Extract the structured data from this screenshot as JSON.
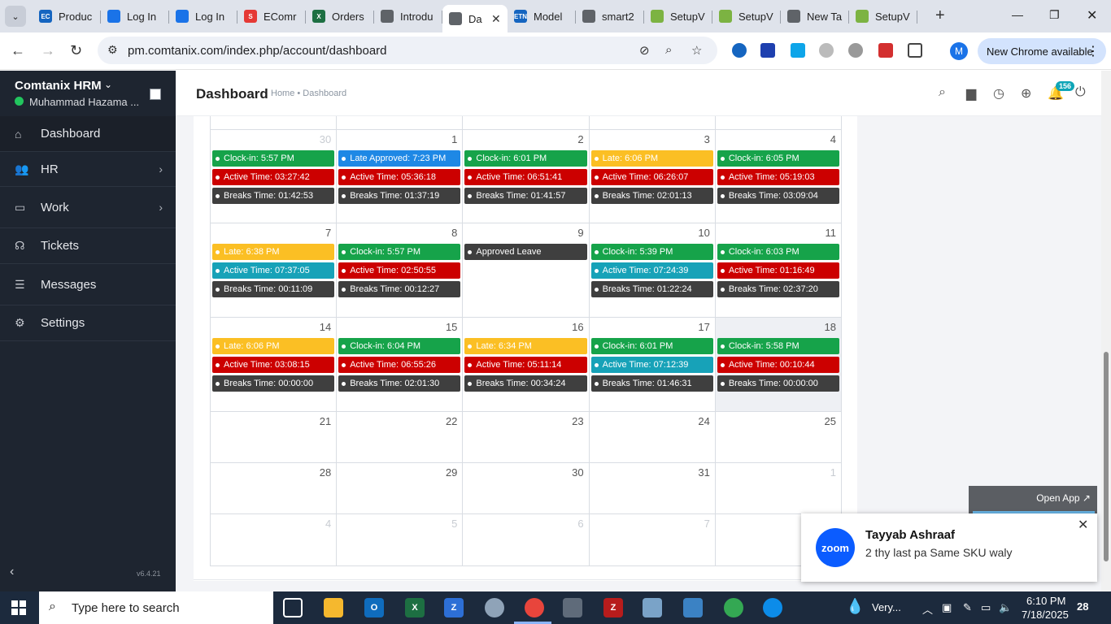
{
  "browser": {
    "tabs": [
      {
        "title": "Produc",
        "fav_text": "EC",
        "fav_color": "#1565c0",
        "active": false
      },
      {
        "title": "Log In",
        "fav_text": "",
        "fav_color": "#1a73e8",
        "active": false
      },
      {
        "title": "Log In",
        "fav_text": "",
        "fav_color": "#1a73e8",
        "active": false
      },
      {
        "title": "EComr",
        "fav_text": "S",
        "fav_color": "#e53935",
        "active": false
      },
      {
        "title": "Orders",
        "fav_text": "X",
        "fav_color": "#1d6f42",
        "active": false
      },
      {
        "title": "Introdu",
        "fav_text": "",
        "fav_color": "#5f6368",
        "active": false
      },
      {
        "title": "Da",
        "fav_text": "",
        "fav_color": "#5f6368",
        "active": true
      },
      {
        "title": "Model",
        "fav_text": "ETN",
        "fav_color": "#1565c0",
        "active": false
      },
      {
        "title": "smart2",
        "fav_text": "",
        "fav_color": "#5f6368",
        "active": false
      },
      {
        "title": "SetupV",
        "fav_text": "",
        "fav_color": "#7cb342",
        "active": false
      },
      {
        "title": "SetupV",
        "fav_text": "",
        "fav_color": "#7cb342",
        "active": false
      },
      {
        "title": "New Ta",
        "fav_text": "",
        "fav_color": "#5f6368",
        "active": false
      },
      {
        "title": "SetupV",
        "fav_text": "",
        "fav_color": "#7cb342",
        "active": false
      }
    ],
    "url": "pm.comtanix.com/index.php/account/dashboard",
    "profile_initial": "M",
    "update_label": "New Chrome available"
  },
  "sidebar": {
    "brand": "Comtanix HRM",
    "user": "Muhammad Hazama ...",
    "items": [
      {
        "label": "Dashboard",
        "icon": "home-icon",
        "glyph": "⌂",
        "chevron": false,
        "active": true
      },
      {
        "label": "HR",
        "icon": "users-icon",
        "glyph": "👥",
        "chevron": true,
        "active": false
      },
      {
        "label": "Work",
        "icon": "briefcase-icon",
        "glyph": "▭",
        "chevron": true,
        "active": false
      },
      {
        "label": "Tickets",
        "icon": "headset-icon",
        "glyph": "☊",
        "chevron": false,
        "active": false
      },
      {
        "label": "Messages",
        "icon": "messages-icon",
        "glyph": "☰",
        "chevron": false,
        "active": false
      },
      {
        "label": "Settings",
        "icon": "gear-icon",
        "glyph": "⚙",
        "chevron": false,
        "active": false
      }
    ],
    "version": "v6.4.21"
  },
  "header": {
    "title": "Dashboard",
    "breadcrumb": "Home • Dashboard",
    "notification_count": "156"
  },
  "calendar": {
    "weeks": [
      {
        "height": 115,
        "days": [
          {
            "num": "30",
            "other": true,
            "events": [
              {
                "text": "Clock-in: 5:57 PM",
                "color": "green"
              },
              {
                "text": "Active Time: 03:27:42",
                "color": "red"
              },
              {
                "text": "Breaks Time: 01:42:53",
                "color": "dark"
              }
            ]
          },
          {
            "num": "1",
            "other": false,
            "events": [
              {
                "text": "Late Approved: 7:23 PM",
                "color": "blue"
              },
              {
                "text": "Active Time: 05:36:18",
                "color": "red"
              },
              {
                "text": "Breaks Time: 01:37:19",
                "color": "dark"
              }
            ]
          },
          {
            "num": "2",
            "other": false,
            "events": [
              {
                "text": "Clock-in: 6:01 PM",
                "color": "green"
              },
              {
                "text": "Active Time: 06:51:41",
                "color": "red"
              },
              {
                "text": "Breaks Time: 01:41:57",
                "color": "dark"
              }
            ]
          },
          {
            "num": "3",
            "other": false,
            "events": [
              {
                "text": "Late: 6:06 PM",
                "color": "yellow"
              },
              {
                "text": "Active Time: 06:26:07",
                "color": "red"
              },
              {
                "text": "Breaks Time: 02:01:13",
                "color": "dark"
              }
            ]
          },
          {
            "num": "4",
            "other": false,
            "events": [
              {
                "text": "Clock-in: 6:05 PM",
                "color": "green"
              },
              {
                "text": "Active Time: 05:19:03",
                "color": "red"
              },
              {
                "text": "Breaks Time: 03:09:04",
                "color": "dark"
              }
            ]
          }
        ]
      },
      {
        "height": 116,
        "days": [
          {
            "num": "7",
            "other": false,
            "events": [
              {
                "text": "Late: 6:38 PM",
                "color": "yellow"
              },
              {
                "text": "Active Time: 07:37:05",
                "color": "teal"
              },
              {
                "text": "Breaks Time: 00:11:09",
                "color": "dark"
              }
            ]
          },
          {
            "num": "8",
            "other": false,
            "events": [
              {
                "text": "Clock-in: 5:57 PM",
                "color": "green"
              },
              {
                "text": "Active Time: 02:50:55",
                "color": "red"
              },
              {
                "text": "Breaks Time: 00:12:27",
                "color": "dark"
              }
            ]
          },
          {
            "num": "9",
            "other": false,
            "events": [
              {
                "text": "Approved Leave",
                "color": "dark"
              }
            ]
          },
          {
            "num": "10",
            "other": false,
            "events": [
              {
                "text": "Clock-in: 5:39 PM",
                "color": "green"
              },
              {
                "text": "Active Time: 07:24:39",
                "color": "teal"
              },
              {
                "text": "Breaks Time: 01:22:24",
                "color": "dark"
              }
            ]
          },
          {
            "num": "11",
            "other": false,
            "events": [
              {
                "text": "Clock-in: 6:03 PM",
                "color": "green"
              },
              {
                "text": "Active Time: 01:16:49",
                "color": "red"
              },
              {
                "text": "Breaks Time: 02:37:20",
                "color": "dark"
              }
            ]
          }
        ]
      },
      {
        "height": 116,
        "days": [
          {
            "num": "14",
            "other": false,
            "events": [
              {
                "text": "Late: 6:06 PM",
                "color": "yellow"
              },
              {
                "text": "Active Time: 03:08:15",
                "color": "red"
              },
              {
                "text": "Breaks Time: 00:00:00",
                "color": "dark"
              }
            ]
          },
          {
            "num": "15",
            "other": false,
            "events": [
              {
                "text": "Clock-in: 6:04 PM",
                "color": "green"
              },
              {
                "text": "Active Time: 06:55:26",
                "color": "red"
              },
              {
                "text": "Breaks Time: 02:01:30",
                "color": "dark"
              }
            ]
          },
          {
            "num": "16",
            "other": false,
            "events": [
              {
                "text": "Late: 6:34 PM",
                "color": "yellow"
              },
              {
                "text": "Active Time: 05:11:14",
                "color": "red"
              },
              {
                "text": "Breaks Time: 00:34:24",
                "color": "dark"
              }
            ]
          },
          {
            "num": "17",
            "other": false,
            "events": [
              {
                "text": "Clock-in: 6:01 PM",
                "color": "green"
              },
              {
                "text": "Active Time: 07:12:39",
                "color": "teal"
              },
              {
                "text": "Breaks Time: 01:46:31",
                "color": "dark"
              }
            ]
          },
          {
            "num": "18",
            "other": false,
            "today": true,
            "events": [
              {
                "text": "Clock-in: 5:58 PM",
                "color": "green"
              },
              {
                "text": "Active Time: 00:10:44",
                "color": "red"
              },
              {
                "text": "Breaks Time: 00:00:00",
                "color": "dark"
              }
            ]
          }
        ]
      },
      {
        "height": 63,
        "days": [
          {
            "num": "21",
            "other": false,
            "events": []
          },
          {
            "num": "22",
            "other": false,
            "events": []
          },
          {
            "num": "23",
            "other": false,
            "events": []
          },
          {
            "num": "24",
            "other": false,
            "events": []
          },
          {
            "num": "25",
            "other": false,
            "events": []
          }
        ]
      },
      {
        "height": 63,
        "days": [
          {
            "num": "28",
            "other": false,
            "events": []
          },
          {
            "num": "29",
            "other": false,
            "events": []
          },
          {
            "num": "30",
            "other": false,
            "events": []
          },
          {
            "num": "31",
            "other": false,
            "events": []
          },
          {
            "num": "1",
            "other": true,
            "events": []
          }
        ]
      },
      {
        "height": 64,
        "days": [
          {
            "num": "4",
            "other": true,
            "events": []
          },
          {
            "num": "5",
            "other": true,
            "events": []
          },
          {
            "num": "6",
            "other": true,
            "events": []
          },
          {
            "num": "7",
            "other": true,
            "events": []
          },
          {
            "num": "",
            "other": true,
            "events": []
          }
        ]
      }
    ]
  },
  "zoom": {
    "open_app": "Open App ↗",
    "logo_text": "zoom",
    "sender": "Tayyab Ashraaf",
    "message": "2 thy last pa Same SKU waly"
  },
  "taskbar": {
    "search_placeholder": "Type here to search",
    "weather": "Very...",
    "time": "6:10 PM",
    "date": "7/18/2025",
    "notification_count": "28"
  }
}
